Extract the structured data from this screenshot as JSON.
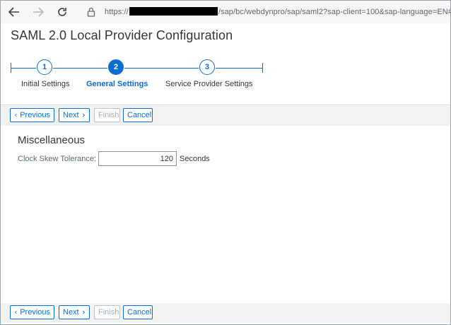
{
  "browser": {
    "url_prefix": "https://",
    "url_suffix": "/sap/bc/webdynpro/sap/saml2?sap-client=100&sap-language=EN#"
  },
  "page": {
    "title": "SAML 2.0 Local Provider Configuration"
  },
  "wizard": {
    "steps": [
      {
        "number": "1",
        "label": "Initial Settings",
        "state": "open"
      },
      {
        "number": "2",
        "label": "General Settings",
        "state": "current"
      },
      {
        "number": "3",
        "label": "Service Provider Settings",
        "state": "open"
      }
    ]
  },
  "toolbar": {
    "previous_label": "Previous",
    "next_label": "Next",
    "finish_label": "Finish",
    "cancel_label": "Cancel"
  },
  "section": {
    "title": "Miscellaneous",
    "clock_skew_label": "Clock Skew Tolerance:",
    "clock_skew_value": "120",
    "clock_skew_unit": "Seconds"
  },
  "colors": {
    "accent": "#0a6ed1",
    "toolbar_bg": "#f2f2f2",
    "browser_bg": "#f7f7f7"
  }
}
